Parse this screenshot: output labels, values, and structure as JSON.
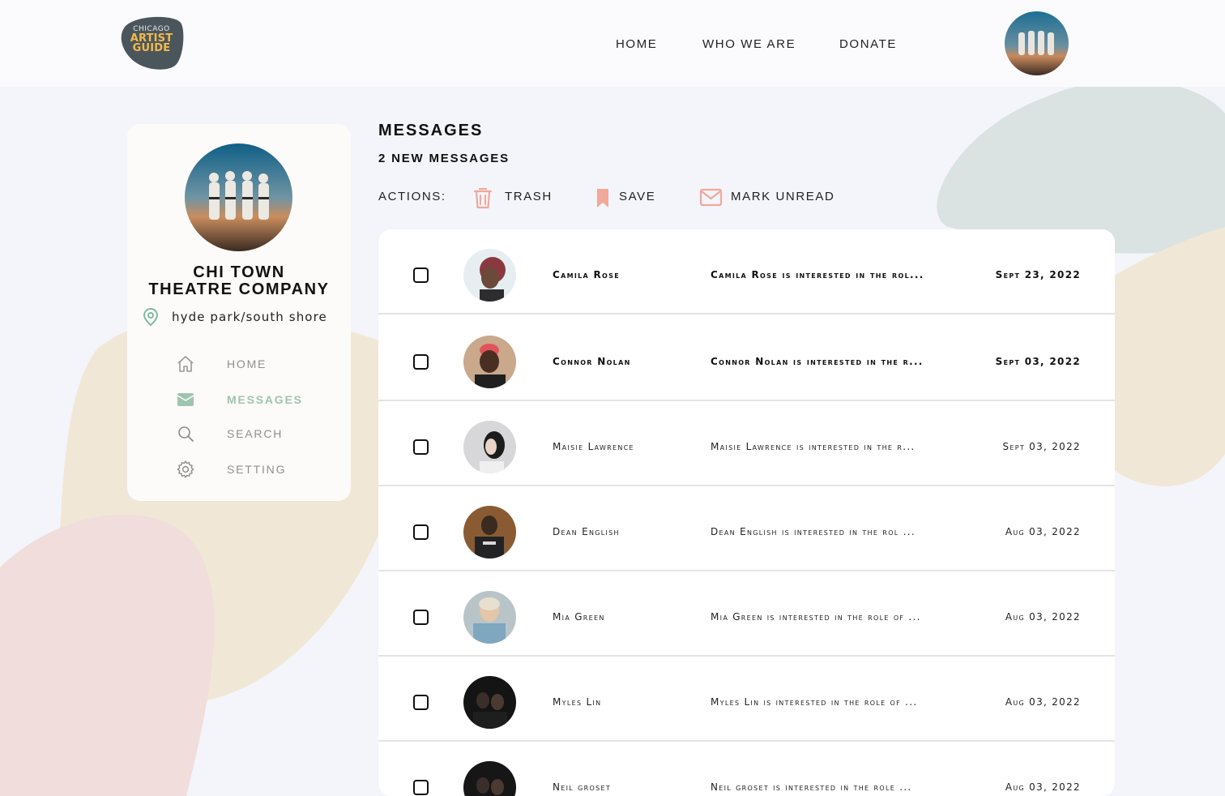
{
  "header": {
    "logo": {
      "line1": "CHICAGO",
      "line2": "ARTIST",
      "line3": "GUIDE"
    },
    "nav": [
      {
        "label": "HOME"
      },
      {
        "label": "WHO WE ARE"
      },
      {
        "label": "DONATE"
      }
    ]
  },
  "profile": {
    "name_line1": "CHI TOWN",
    "name_line2": "THEATRE COMPANY",
    "location": "hyde park/south shore"
  },
  "sidebar": {
    "items": [
      {
        "label": "HOME",
        "icon": "home-icon",
        "active": false
      },
      {
        "label": "MESSAGES",
        "icon": "mail-icon",
        "active": true
      },
      {
        "label": "SEARCH",
        "icon": "search-icon",
        "active": false
      },
      {
        "label": "SETTING",
        "icon": "gear-icon",
        "active": false
      }
    ]
  },
  "main": {
    "title": "MESSAGES",
    "new_count": "2 NEW MESSAGES",
    "actions_label": "ACTIONS:",
    "actions": [
      {
        "label": "TRASH",
        "icon": "trash-icon"
      },
      {
        "label": "SAVE",
        "icon": "bookmark-icon"
      },
      {
        "label": "MARK UNREAD",
        "icon": "envelope-icon"
      }
    ]
  },
  "messages": [
    {
      "name": "Camila Rose",
      "preview": "Camila Rose is interested in the rol...",
      "date": "Sept 23, 2022",
      "unread": true
    },
    {
      "name": "Connor Nolan",
      "preview": "Connor Nolan is interested in the r...",
      "date": "Sept 03, 2022",
      "unread": true
    },
    {
      "name": "Maisie Lawrence",
      "preview": "Maisie Lawrence is interested in the r...",
      "date": "Sept 03, 2022",
      "unread": false
    },
    {
      "name": "Dean English",
      "preview": "Dean English is interested in the rol ...",
      "date": "Aug 03, 2022",
      "unread": false
    },
    {
      "name": "Mia Green",
      "preview": "Mia Green is interested in the role of ...",
      "date": "Aug 03, 2022",
      "unread": false
    },
    {
      "name": "Myles Lin",
      "preview": "Myles Lin is interested in the role of ...",
      "date": "Aug 03, 2022",
      "unread": false
    },
    {
      "name": "Neil groset",
      "preview": "Neil groset is interested in the role ...",
      "date": "Aug 03, 2022",
      "unread": false
    }
  ],
  "colors": {
    "accent_green": "#9fc4b0",
    "action_pink": "#f0a99a",
    "logo_bg": "#4b565c",
    "logo_gold": "#f4b94b"
  }
}
